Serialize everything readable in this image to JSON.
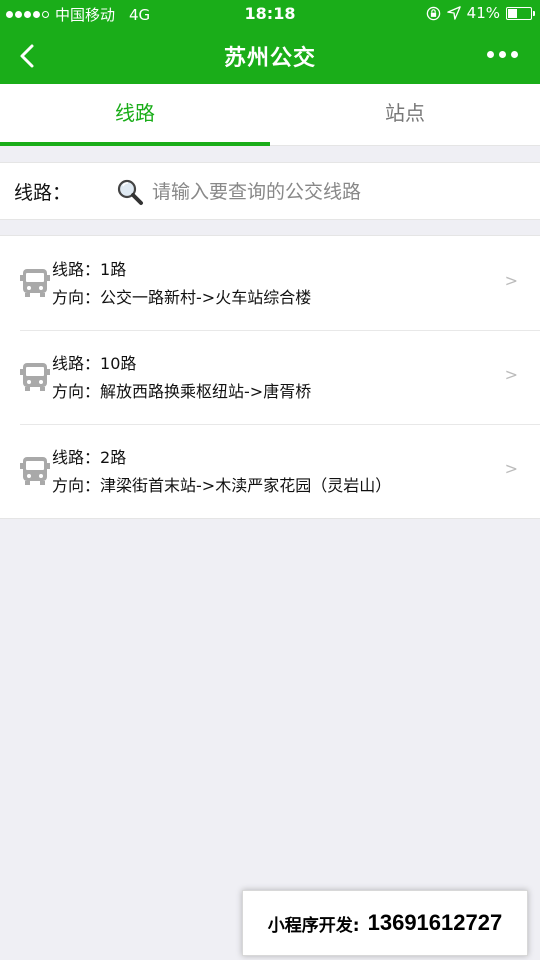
{
  "status_bar": {
    "carrier": "中国移动",
    "network": "4G",
    "time": "18:18",
    "battery": "41%",
    "battery_level": 0.41
  },
  "nav": {
    "title": "苏州公交"
  },
  "tabs": [
    {
      "label": "线路",
      "active": true
    },
    {
      "label": "站点",
      "active": false
    }
  ],
  "search": {
    "label": "线路：",
    "placeholder": "请输入要查询的公交线路",
    "value": ""
  },
  "routes": [
    {
      "line_label": "线路：",
      "line": "1路",
      "dir_label": "方向：",
      "direction": "公交一路新村->火车站综合楼"
    },
    {
      "line_label": "线路：",
      "line": "10路",
      "dir_label": "方向：",
      "direction": "解放西路换乘枢纽站->唐胥桥"
    },
    {
      "line_label": "线路：",
      "line": "2路",
      "dir_label": "方向：",
      "direction": "津梁街首末站->木渎严家花园（灵岩山）"
    }
  ],
  "chevron": ">",
  "watermark": {
    "label": "小程序开发:",
    "phone": "13691612727"
  },
  "colors": {
    "brand": "#1aad19",
    "background": "#efeff4"
  }
}
